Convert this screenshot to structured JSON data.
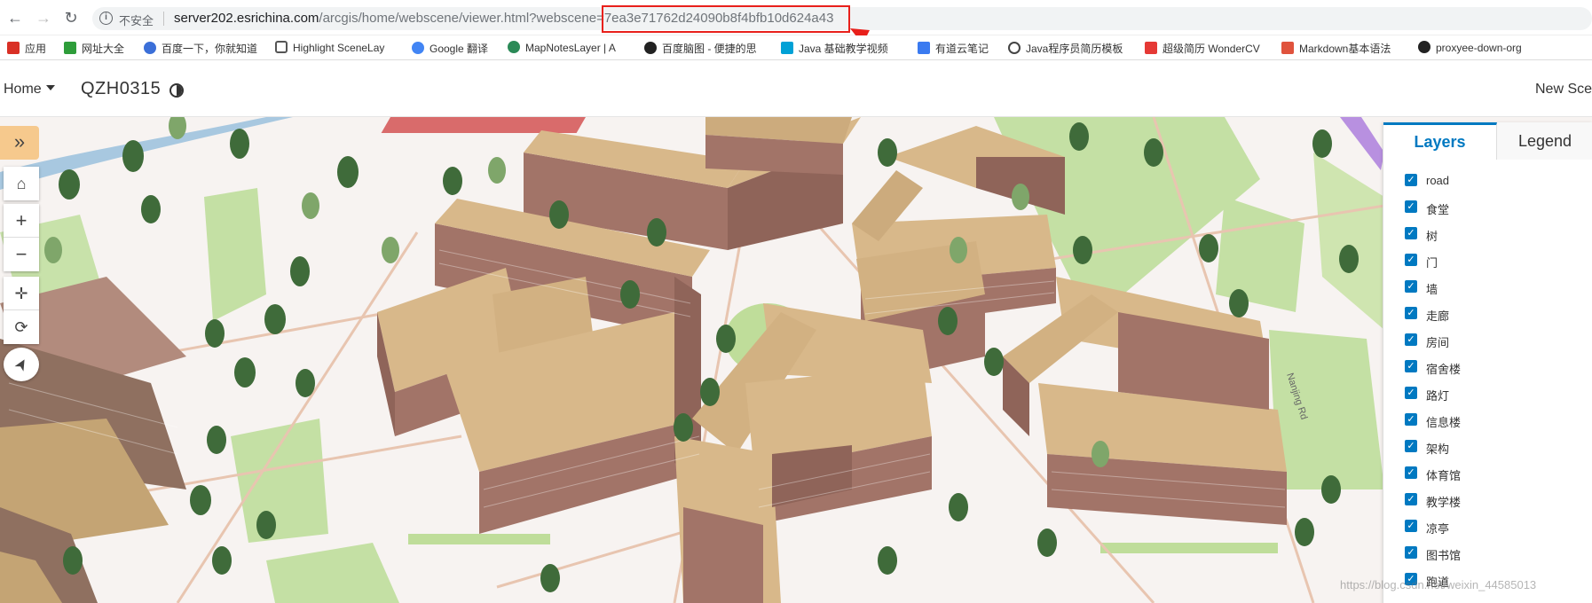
{
  "browser": {
    "security_label": "不安全",
    "url_host": "server202.esrichina.com",
    "url_path": "/arcgis/home/webscene/viewer.html?webscene=",
    "url_id": "7ea3e71762d24090b8f4bfb10d624a43",
    "annotation": "id"
  },
  "bookmarks": [
    {
      "label": "应用",
      "color": "#d93025"
    },
    {
      "label": "网址大全",
      "color": "#2e9d3a"
    },
    {
      "label": "百度一下，你就知道",
      "color": "#3b6fd8"
    },
    {
      "label": "Highlight SceneLay",
      "color": "#555555"
    },
    {
      "label": "Google 翻译",
      "color": "#4285f4"
    },
    {
      "label": "MapNotesLayer | A",
      "color": "#2b8a57"
    },
    {
      "label": "百度脑图 - 便捷的思",
      "color": "#222222"
    },
    {
      "label": "Java 基础教学视频",
      "color": "#00a1d6"
    },
    {
      "label": "有道云笔记",
      "color": "#3a7af0"
    },
    {
      "label": "Java程序员简历模板",
      "color": "#444444"
    },
    {
      "label": "超级简历 WonderCV",
      "color": "#e53935"
    },
    {
      "label": "Markdown基本语法",
      "color": "#e0533d"
    },
    {
      "label": "proxyee-down-org",
      "color": "#222222"
    }
  ],
  "app": {
    "home_label": "Home",
    "scene_title": "QZH0315",
    "new_scene_label": "New Sce"
  },
  "widgets": {
    "expand_icon": "»",
    "home_icon": "⌂",
    "zoom_in": "+",
    "zoom_out": "−",
    "pan_icon": "✛",
    "rotate_icon": "⟳",
    "compass_icon": "➤"
  },
  "panel": {
    "tab_layers": "Layers",
    "tab_legend": "Legend",
    "layers": [
      "road",
      "食堂",
      "树",
      "门",
      "墙",
      "走廊",
      "房间",
      "宿舍楼",
      "路灯",
      "信息楼",
      "架构",
      "体育馆",
      "教学楼",
      "凉亭",
      "图书馆",
      "跑道"
    ]
  },
  "map": {
    "road_label": "Nanjing Rd"
  },
  "watermark": "https://blog.csdn.net/weixin_44585013",
  "colors": {
    "accent": "#0079c1",
    "annotation": "#e8201b",
    "roof": "#d8b88a",
    "wall": "#a97a6e",
    "grass": "#bfdd9a",
    "water": "#a8c8e0"
  }
}
